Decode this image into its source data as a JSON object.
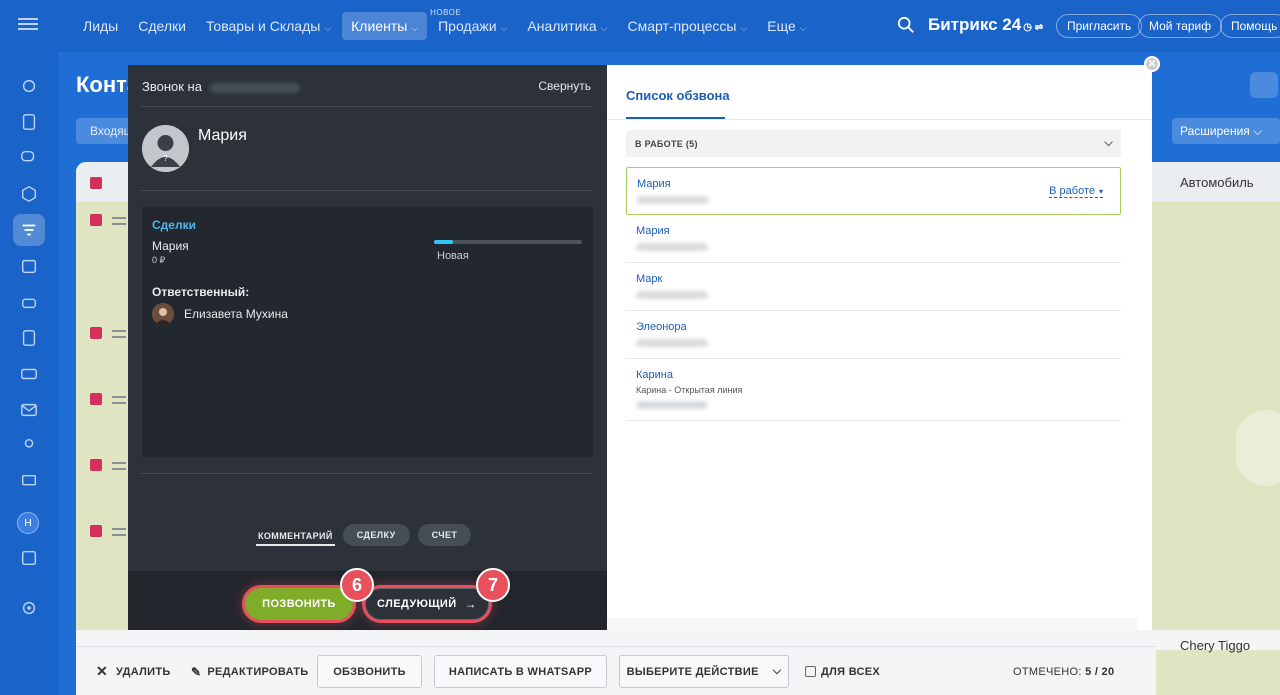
{
  "nav": {
    "items": [
      {
        "label": "Лиды",
        "chevron": false
      },
      {
        "label": "Сделки",
        "chevron": false
      },
      {
        "label": "Товары и Склады",
        "chevron": true
      },
      {
        "label": "Клиенты",
        "chevron": true,
        "active": true
      },
      {
        "label": "Продажи",
        "chevron": true,
        "tag": "НОВОЕ"
      },
      {
        "label": "Аналитика",
        "chevron": true
      },
      {
        "label": "Смарт-процессы",
        "chevron": true
      },
      {
        "label": "Еще",
        "chevron": true
      }
    ],
    "brand": "Битрикс 24",
    "invite": "Пригласить",
    "tariff": "Мой тариф",
    "help": "Помощь"
  },
  "sidebar": {
    "avatar_letter": "Н"
  },
  "background": {
    "page_title": "Конта",
    "filter_label": "Входящ",
    "extensions": "Расширения",
    "col_auto": "Автомобиль",
    "last_row_car": "Chery Tiggo"
  },
  "actionbar": {
    "delete": "УДАЛИТЬ",
    "edit": "РЕДАКТИРОВАТЬ",
    "dial": "ОБЗВОНИТЬ",
    "whatsapp": "НАПИСАТЬ В WHATSAPP",
    "choose_action": "ВЫБЕРИТЕ ДЕЙСТВИЕ",
    "for_all": "ДЛЯ ВСЕХ",
    "selected_label": "ОТМЕЧЕНО:",
    "selected_value": "5 / 20"
  },
  "call": {
    "header": "Звонок на",
    "collapse": "Свернуть",
    "contact_name": "Мария",
    "deals_title": "Сделки",
    "deal_name": "Мария",
    "deal_amount": "0 ₽",
    "stage_label": "Новая",
    "stage_progress": 0.13,
    "responsible_label": "Ответственный:",
    "responsible_name": "Елизавета Мухина",
    "tabs": {
      "comment": "КОММЕНТАРИЙ",
      "deal": "СДЕЛКУ",
      "invoice": "СЧЕТ"
    },
    "call_button": "ПОЗВОНИТЬ",
    "next_button": "СЛЕДУЮЩИЙ",
    "step_call": "6",
    "step_next": "7"
  },
  "list": {
    "tab": "Список обзвона",
    "group": "В РАБОТЕ (5)",
    "status": "В работе",
    "items": [
      {
        "name": "Мария",
        "sub": ""
      },
      {
        "name": "Мария",
        "sub": ""
      },
      {
        "name": "Марк",
        "sub": ""
      },
      {
        "name": "Элеонора",
        "sub": ""
      },
      {
        "name": "Карина",
        "sub": "Карина - Открытая линия"
      }
    ]
  },
  "colors": {
    "accent": "#1a5fb4",
    "call_green": "#7fad29",
    "highlight_red": "#e8505b",
    "stage_blue": "#2fc6f6"
  }
}
